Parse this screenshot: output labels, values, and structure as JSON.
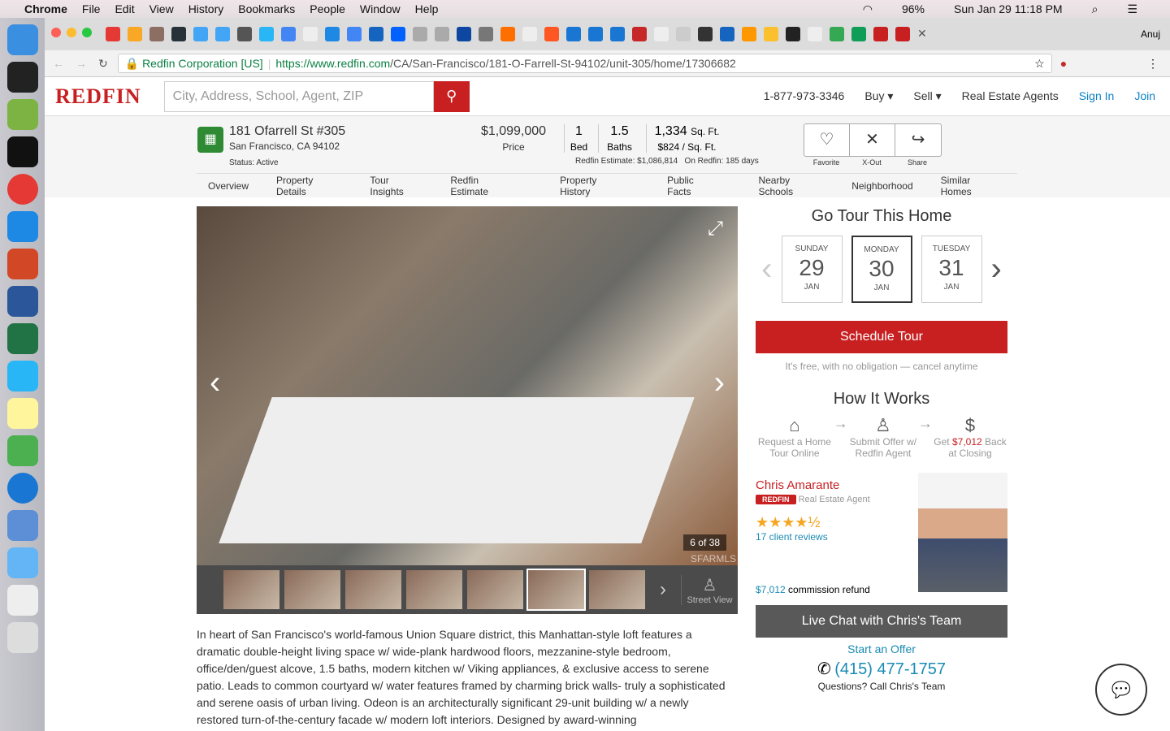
{
  "menubar": {
    "app": "Chrome",
    "items": [
      "File",
      "Edit",
      "View",
      "History",
      "Bookmarks",
      "People",
      "Window",
      "Help"
    ],
    "battery": "96%",
    "clock": "Sun Jan 29  11:18 PM"
  },
  "browser": {
    "user": "Anuj",
    "secure_label": "Redfin Corporation [US]",
    "url_host": "https://www.redfin.com",
    "url_path": "/CA/San-Francisco/181-O-Farrell-St-94102/unit-305/home/17306682"
  },
  "header": {
    "logo": "REDFIN",
    "search_placeholder": "City, Address, School, Agent, ZIP",
    "phone": "1-877-973-3346",
    "buy": "Buy ▾",
    "sell": "Sell ▾",
    "agents": "Real Estate Agents",
    "signin": "Sign In",
    "join": "Join"
  },
  "property": {
    "address": "181 Ofarrell St #305",
    "city": "San Francisco, CA 94102",
    "status": "Status: Active",
    "price": "$1,099,000",
    "price_label": "Price",
    "beds": "1",
    "beds_label": "Bed",
    "baths": "1.5",
    "baths_label": "Baths",
    "sqft": "1,334",
    "sqft_unit": "Sq. Ft.",
    "per_sqft": "$824 / Sq. Ft.",
    "estimate": "Redfin Estimate: $1,086,814",
    "on_redfin": "On Redfin: 185 days"
  },
  "actions": [
    "Favorite",
    "X-Out",
    "Share"
  ],
  "tabs": [
    "Overview",
    "Property Details",
    "Tour Insights",
    "Redfin Estimate",
    "Property History",
    "Public Facts",
    "Nearby Schools",
    "Neighborhood",
    "Similar Homes"
  ],
  "gallery": {
    "counter": "6 of 38",
    "street_view": "Street View",
    "watermark": "SFARMLS"
  },
  "description": "In heart of San Francisco's world-famous Union Square district, this Manhattan-style loft features a dramatic double-height living space w/ wide-plank hardwood floors, mezzanine-style bedroom, office/den/guest alcove, 1.5 baths, modern kitchen w/ Viking appliances, & exclusive access to serene patio. Leads to common courtyard w/ water features framed by charming brick walls- truly a sophisticated and serene oasis of urban living. Odeon is an architecturally significant 29-unit building w/ a newly restored turn-of-the-century facade w/ modern loft interiors. Designed by award-winning",
  "tour": {
    "title": "Go Tour This Home",
    "days": [
      {
        "dow": "SUNDAY",
        "num": "29",
        "mon": "JAN"
      },
      {
        "dow": "MONDAY",
        "num": "30",
        "mon": "JAN"
      },
      {
        "dow": "TUESDAY",
        "num": "31",
        "mon": "JAN"
      }
    ],
    "button": "Schedule Tour",
    "note": "It's free, with no obligation — cancel anytime"
  },
  "how": {
    "title": "How It Works",
    "step1": "Request a Home Tour Online",
    "step2": "Submit Offer w/ Redfin Agent",
    "step3a": "Get ",
    "step3b": "$7,012",
    "step3c": " Back at Closing"
  },
  "agent": {
    "name": "Chris Amarante",
    "badge": "REDFIN",
    "role": "Real Estate Agent",
    "rating": 4.5,
    "stars": "★★★★½",
    "reviews": "17 client reviews",
    "refund_amt": "$7,012",
    "refund_label": " commission refund",
    "chat": "Live Chat with Chris's Team",
    "offer": "Start an Offer",
    "phone": "(415) 477-1757",
    "call": "Questions? Call Chris's Team"
  }
}
